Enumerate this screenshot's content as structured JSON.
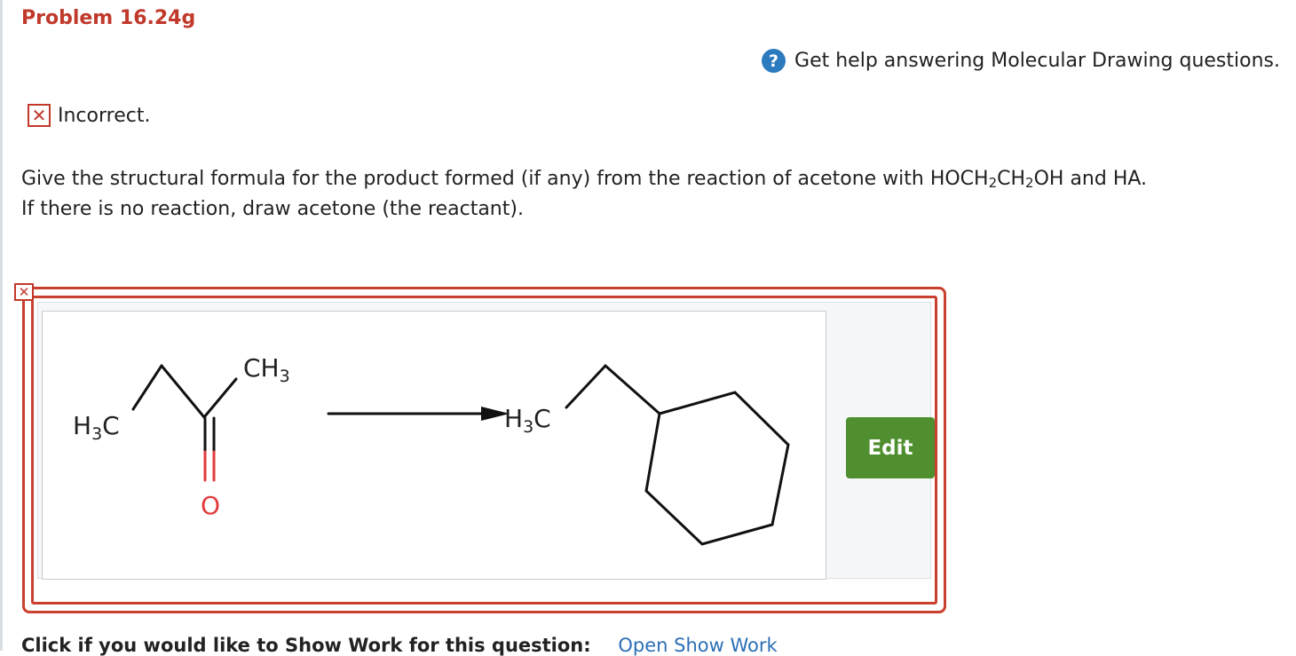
{
  "problem": {
    "title": "Problem 16.24g"
  },
  "help": {
    "icon": "question-circle-icon",
    "icon_glyph": "?",
    "text": "Get help answering Molecular Drawing questions."
  },
  "status": {
    "icon": "incorrect-x-icon",
    "icon_glyph": "✕",
    "text": "Incorrect."
  },
  "question": {
    "part1": "Give the structural formula for the product formed (if any) from the reaction of acetone with HOCH",
    "sub1": "2",
    "part2": "CH",
    "sub2": "2",
    "part3": "OH and HA.",
    "line2": "If there is no reaction, draw acetone (the reactant)."
  },
  "answer": {
    "marker_glyph": "✕",
    "edit_label": "Edit",
    "labels": {
      "reactant_ch3": "CH",
      "reactant_ch3_sub": "3",
      "reactant_h3c_h": "H",
      "reactant_h3c_sub": "3",
      "reactant_h3c_c": "C",
      "reactant_o": "O",
      "product_h3c_h": "H",
      "product_h3c_sub": "3",
      "product_h3c_c": "C"
    }
  },
  "show_work": {
    "label": "Click if you would like to Show Work for this question:",
    "link": "Open Show Work"
  },
  "colors": {
    "problem_title": "#c0392b",
    "error_border": "#c9402f",
    "edit_button": "#4f8f2f",
    "help_icon": "#2c7bbf",
    "oxygen": "#e23b3b",
    "link": "#2c6fb7"
  }
}
